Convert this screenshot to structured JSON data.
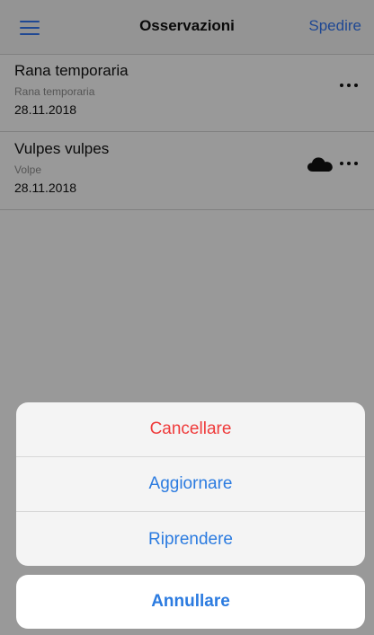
{
  "navbar": {
    "title": "Osservazioni",
    "send_label": "Spedire",
    "menu_icon": "hamburger-menu-icon",
    "accent_color": "#3478f6"
  },
  "observations": [
    {
      "name": "Rana temporaria",
      "common_name": "Rana temporaria",
      "date": "28.11.2018",
      "synced_icon": null
    },
    {
      "name": "Vulpes vulpes",
      "common_name": "Volpe",
      "date": "28.11.2018",
      "synced_icon": "cloud-icon"
    }
  ],
  "action_sheet": {
    "actions": [
      {
        "label": "Cancellare",
        "style": "destructive",
        "color": "#ef3b3b"
      },
      {
        "label": "Aggiornare",
        "style": "default",
        "color": "#2b7be0"
      },
      {
        "label": "Riprendere",
        "style": "default",
        "color": "#2b7be0"
      }
    ],
    "cancel_label": "Annullare"
  }
}
